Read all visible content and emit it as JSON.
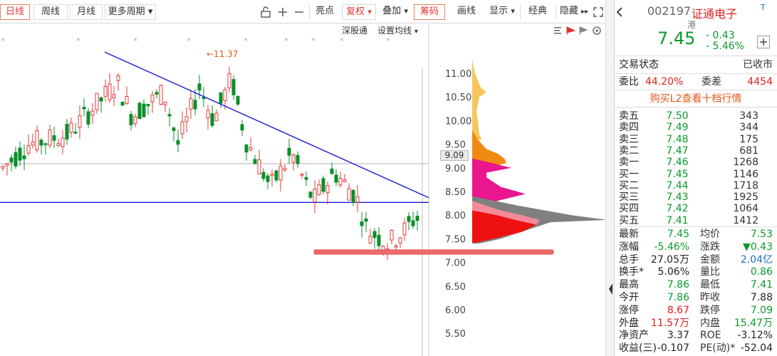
{
  "toolbar": {
    "tabs": [
      "日线",
      "周线",
      "月线"
    ],
    "more_period": "更多周期",
    "more_period_arrow": "▾",
    "icon_names": [
      "unlock-icon",
      "plus-icon",
      "minus-icon"
    ],
    "liangdian": "亮点",
    "fuquan": "复权",
    "fuquan_arrow": "▾",
    "diejia": "叠加",
    "diejia_arrow": "▾",
    "chouma": "筹码",
    "huaxian": "画线",
    "xianshi": "显示",
    "xianshi_arrow": "▾",
    "jingdian": "经典",
    "yincang": "隐藏",
    "yincang_arrow": "▸▸",
    "expand_icon": "expand-icon"
  },
  "chart": {
    "shengutong": "深股通",
    "set_ma": "设置均线",
    "set_ma_arrow": "▾",
    "high_marker": "←11.37",
    "price_ticks": [
      "11.00",
      "10.50",
      "10.00",
      "9.50",
      "9.00",
      "8.50",
      "8.00",
      "7.50",
      "7.00",
      "6.50",
      "6.00",
      "5.50"
    ],
    "current_label": "9.09",
    "colors": {
      "up": "#e23b3b",
      "down": "#0a8f2a",
      "trend": "#1a1ad6",
      "highlight": "#f06a6a"
    }
  },
  "chart_data": {
    "type": "candlestick",
    "y_axis_range": [
      5.3,
      11.3
    ],
    "horizontal_lines": [
      9.09,
      8.27
    ],
    "high_value": 11.37,
    "last_close": 7.45
  },
  "quote": {
    "code": "002197",
    "name": "证通电子",
    "tag": "港",
    "tag2": "T",
    "price": "7.45",
    "change": "- 0.43",
    "change_pct": "- 5.46%",
    "trade_status_label": "交易状态",
    "trade_status_value": "已收市",
    "weibi_label": "委比",
    "weibi_value": "44.20%",
    "weicha_label": "委差",
    "weicha_value": "4454",
    "l2_link": "购买L2查看十档行情",
    "sells": [
      {
        "label": "卖五",
        "price": "7.50",
        "vol": "343"
      },
      {
        "label": "卖四",
        "price": "7.49",
        "vol": "344"
      },
      {
        "label": "卖三",
        "price": "7.48",
        "vol": "175"
      },
      {
        "label": "卖二",
        "price": "7.47",
        "vol": "681"
      },
      {
        "label": "卖一",
        "price": "7.46",
        "vol": "1268"
      }
    ],
    "buys": [
      {
        "label": "买一",
        "price": "7.45",
        "vol": "1146"
      },
      {
        "label": "买二",
        "price": "7.44",
        "vol": "1718"
      },
      {
        "label": "买三",
        "price": "7.43",
        "vol": "1925"
      },
      {
        "label": "买四",
        "price": "7.42",
        "vol": "1064"
      },
      {
        "label": "买五",
        "price": "7.41",
        "vol": "1412"
      }
    ],
    "stats": [
      {
        "l1": "最新",
        "v1": "7.45",
        "c1": "green",
        "l2": "均价",
        "v2": "7.53",
        "c2": "green"
      },
      {
        "l1": "涨幅",
        "v1": "-5.46%",
        "c1": "green",
        "l2": "涨跌",
        "v2": "▼0.43",
        "c2": "green"
      },
      {
        "l1": "总手",
        "v1": "27.05万",
        "c1": "dark",
        "l2": "金额",
        "v2": "2.04亿",
        "c2": "blue"
      },
      {
        "l1": "换手*",
        "v1": "5.06%",
        "c1": "dark",
        "l2": "量比",
        "v2": "0.86",
        "c2": "green"
      },
      {
        "l1": "最高",
        "v1": "7.86",
        "c1": "green",
        "l2": "最低",
        "v2": "7.41",
        "c2": "green"
      },
      {
        "l1": "今开",
        "v1": "7.86",
        "c1": "green",
        "l2": "昨收",
        "v2": "7.88",
        "c2": "dark"
      },
      {
        "l1": "涨停",
        "v1": "8.67",
        "c1": "red",
        "l2": "跌停",
        "v2": "7.09",
        "c2": "green"
      },
      {
        "l1": "外盘",
        "v1": "11.57万",
        "c1": "red",
        "l2": "内盘",
        "v2": "15.47万",
        "c2": "green"
      },
      {
        "l1": "净资产",
        "v1": "3.37",
        "c1": "dark",
        "l2": "ROE",
        "v2": "-3.12%",
        "c2": "dark"
      },
      {
        "l1": "收益(三)",
        "v1": "-0.107",
        "c1": "dark",
        "l2": "PE(动)*",
        "v2": "-52.04",
        "c2": "dark"
      }
    ]
  }
}
